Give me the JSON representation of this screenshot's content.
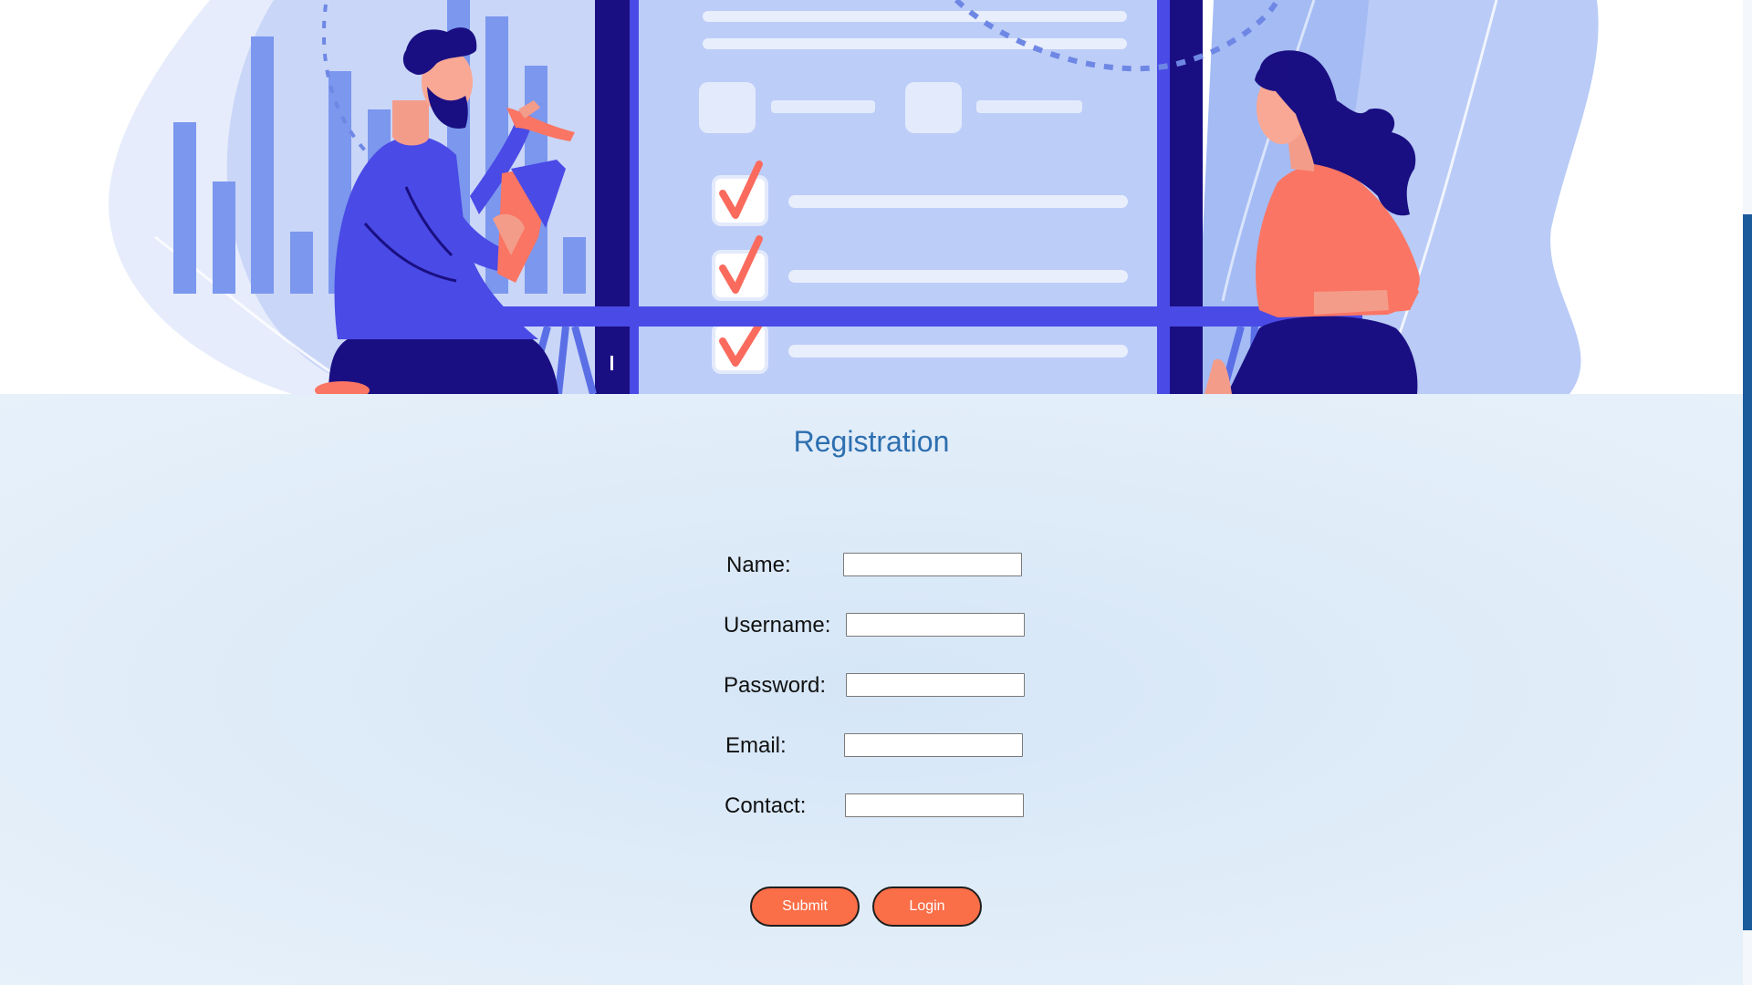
{
  "form": {
    "title": "Registration",
    "fields": [
      {
        "label": "Name:",
        "value": "",
        "placeholder": ""
      },
      {
        "label": "Username:",
        "value": "",
        "placeholder": ""
      },
      {
        "label": "Password:",
        "value": "",
        "placeholder": ""
      },
      {
        "label": "Email:",
        "value": "",
        "placeholder": ""
      },
      {
        "label": "Contact:",
        "value": "",
        "placeholder": ""
      }
    ],
    "submit_label": "Submit",
    "login_label": "Login"
  },
  "colors": {
    "title": "#2e6fb0",
    "button": "#fa6e48",
    "illustration_dark": "#1a0f82",
    "illustration_mid": "#4a4ae6",
    "illustration_light": "#bccdf8",
    "accent_coral": "#fa7563"
  },
  "hero": {
    "icons": [
      "bar-chart-icon",
      "man-figure-icon",
      "clipboard-icon",
      "checkmark-icon",
      "woman-figure-icon"
    ]
  }
}
